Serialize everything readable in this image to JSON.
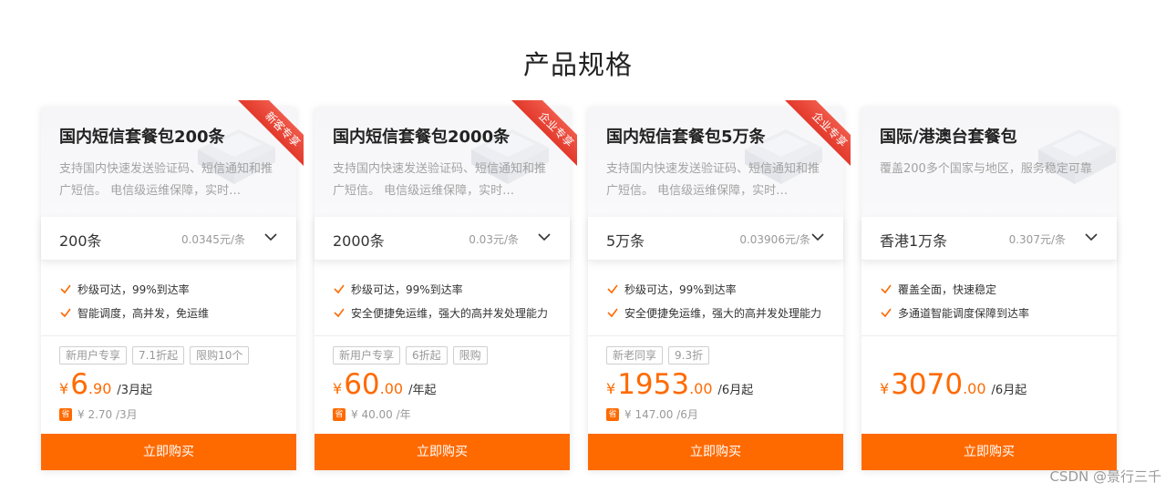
{
  "page": {
    "title": "产品规格"
  },
  "cards": [
    {
      "title": "国内短信套餐包200条",
      "desc": "支持国内快速发送验证码、短信通知和推广短信。 电信级运维保障，实时…",
      "ribbon": "新客专享",
      "spec": "200条",
      "unit_price": "0.0345元/条",
      "features": [
        "秒级可达，99%到达率",
        "智能调度，高并发，免运维"
      ],
      "tags": [
        "新用户专享",
        "7.1折起",
        "限购10个"
      ],
      "price": {
        "yen": "¥",
        "int": "6",
        "dec": ".90",
        "period": "/3月起"
      },
      "original": {
        "badge": "省",
        "text": "¥ 2.70 /3月"
      },
      "buy": "立即购买"
    },
    {
      "title": "国内短信套餐包2000条",
      "desc": "支持国内快速发送验证码、短信通知和推广短信。 电信级运维保障，实时…",
      "ribbon": "企业专享",
      "spec": "2000条",
      "unit_price": "0.03元/条",
      "features": [
        "秒级可达，99%到达率",
        "安全便捷免运维，强大的高并发处理能力"
      ],
      "tags": [
        "新用户专享",
        "6折起",
        "限购"
      ],
      "price": {
        "yen": "¥",
        "int": "60",
        "dec": ".00",
        "period": "/年起"
      },
      "original": {
        "badge": "省",
        "text": "¥ 40.00 /年"
      },
      "buy": "立即购买"
    },
    {
      "title": "国内短信套餐包5万条",
      "desc": "支持国内快速发送验证码、短信通知和推广短信。 电信级运维保障，实时…",
      "ribbon": "企业专享",
      "spec": "5万条",
      "unit_price": "0.03906元/条",
      "features": [
        "秒级可达，99%到达率",
        "安全便捷免运维，强大的高并发处理能力"
      ],
      "tags": [
        "新老同享",
        "9.3折"
      ],
      "price": {
        "yen": "¥",
        "int": "1953",
        "dec": ".00",
        "period": "/6月起"
      },
      "original": {
        "badge": "省",
        "text": "¥ 147.00 /6月"
      },
      "buy": "立即购买"
    },
    {
      "title": "国际/港澳台套餐包",
      "desc": "覆盖200多个国家与地区，服务稳定可靠",
      "spec": "香港1万条",
      "unit_price": "0.307元/条",
      "features": [
        "覆盖全面，快速稳定",
        "多通道智能调度保障到达率"
      ],
      "price": {
        "yen": "¥",
        "int": "3070",
        "dec": ".00",
        "period": "/6月起"
      },
      "buy": "立即购买"
    }
  ],
  "watermark": "CSDN @景行三千",
  "colors": {
    "accent": "#ff6a00",
    "ribbon": "#e2392b"
  }
}
